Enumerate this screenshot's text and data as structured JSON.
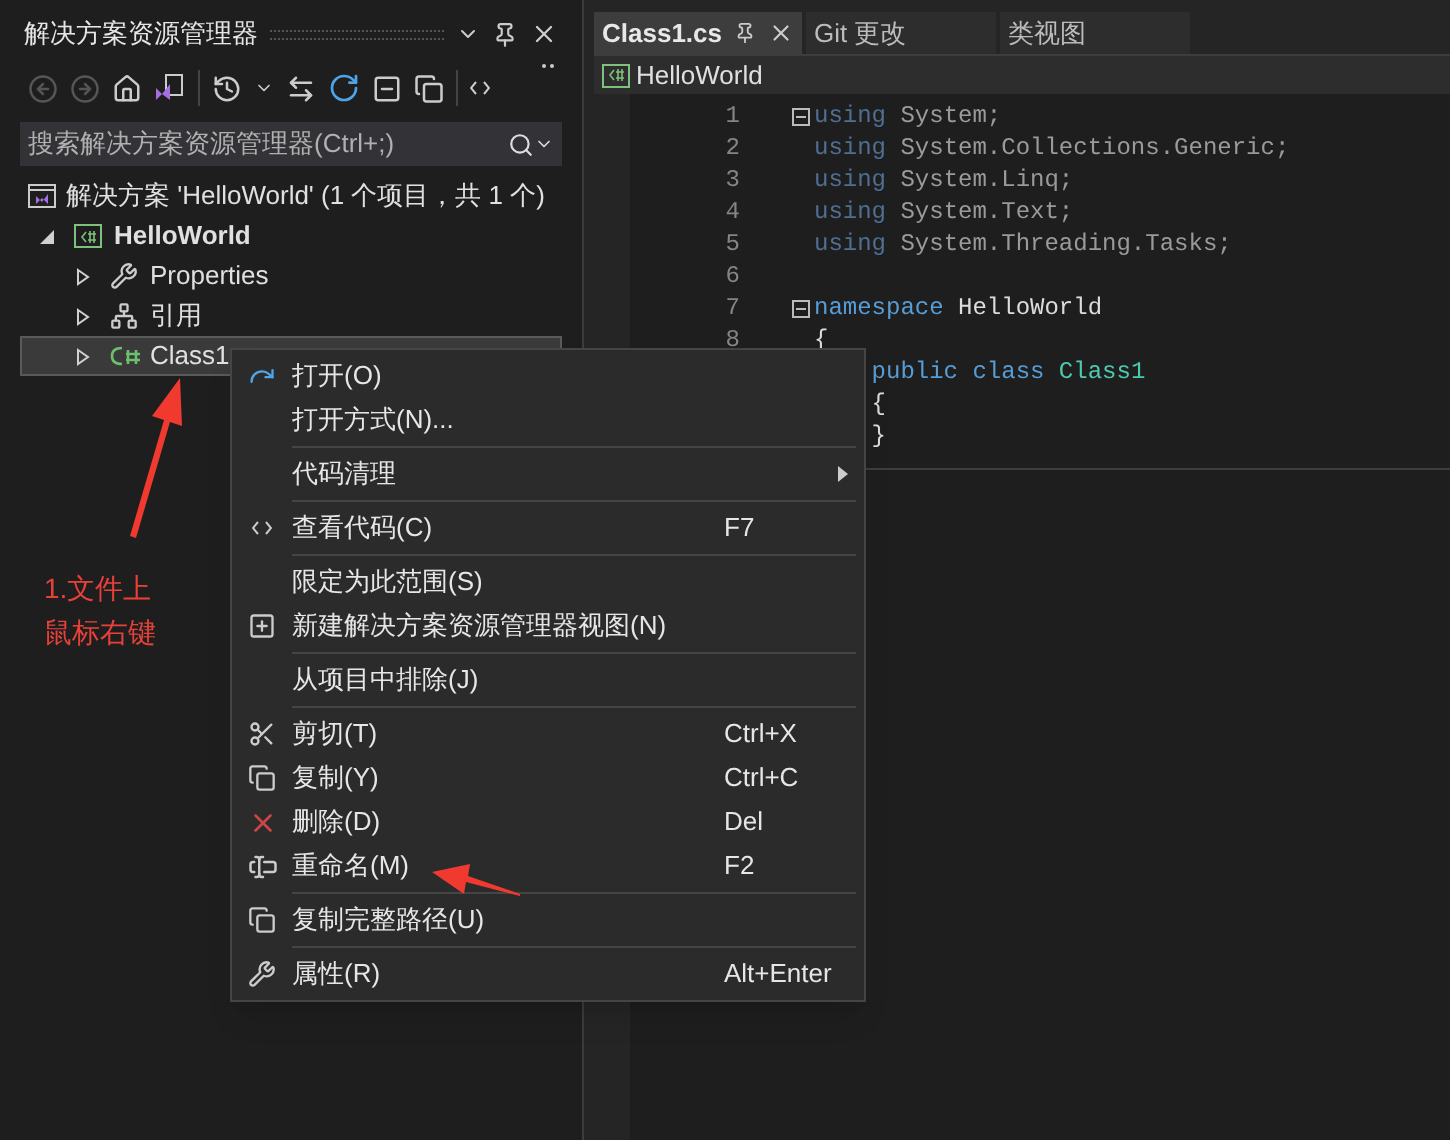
{
  "solution_explorer": {
    "title": "解决方案资源管理器",
    "search": {
      "placeholder": "搜索解决方案资源管理器(Ctrl+;)"
    },
    "tree": [
      {
        "label": "解决方案 'HelloWorld' (1 个项目，共 1 个)",
        "kind": "solution",
        "selected": false,
        "children": [
          {
            "label": "HelloWorld",
            "kind": "project",
            "selected": false,
            "expanded": true,
            "children": [
              {
                "label": "Properties",
                "kind": "properties",
                "selected": false,
                "expanded": false
              },
              {
                "label": "引用",
                "kind": "references",
                "selected": false,
                "expanded": false
              },
              {
                "label": "Class1",
                "kind": "csfile",
                "selected": true,
                "expanded": false
              }
            ]
          }
        ]
      }
    ]
  },
  "editor": {
    "tabs": [
      {
        "label": "Class1.cs",
        "selected": true
      },
      {
        "label": "Git 更改",
        "selected": false
      },
      {
        "label": "类视图",
        "selected": false
      }
    ],
    "navigation": "HelloWorld",
    "lines": [
      {
        "number": "1",
        "fold": true,
        "tokens": [
          {
            "text": "using",
            "kind": "dim"
          },
          {
            "text": " System;",
            "kind": "plain_dim"
          }
        ]
      },
      {
        "number": "2",
        "fold": false,
        "tokens": [
          {
            "text": "using",
            "kind": "dim"
          },
          {
            "text": " System.Collections.Generic;",
            "kind": "plain_dim"
          }
        ]
      },
      {
        "number": "3",
        "fold": false,
        "tokens": [
          {
            "text": "using",
            "kind": "dim"
          },
          {
            "text": " System.Linq;",
            "kind": "plain_dim"
          }
        ]
      },
      {
        "number": "4",
        "fold": false,
        "tokens": [
          {
            "text": "using",
            "kind": "dim"
          },
          {
            "text": " System.Text;",
            "kind": "plain_dim"
          }
        ]
      },
      {
        "number": "5",
        "fold": false,
        "tokens": [
          {
            "text": "using",
            "kind": "dim"
          },
          {
            "text": " System.Threading.Tasks;",
            "kind": "plain_dim"
          }
        ]
      },
      {
        "number": "6"
      },
      {
        "number": "7",
        "fold": true,
        "tokens": [
          {
            "text": "namespace",
            "kind": "keyword"
          },
          {
            "text": " HelloWorld",
            "kind": "plain"
          }
        ]
      },
      {
        "number": "8",
        "fold": false,
        "tokens": [
          {
            "text": "{",
            "kind": "plain"
          }
        ]
      },
      {
        "fold": false,
        "tokens": [
          {
            "text": "    public",
            "kind": "keyword"
          },
          {
            "text": " class",
            "kind": "keyword"
          },
          {
            "text": " Class1",
            "kind": "type"
          }
        ]
      },
      {
        "fold": false,
        "tokens": [
          {
            "text": "    {",
            "kind": "plain"
          }
        ]
      },
      {
        "fold": false,
        "tokens": [
          {
            "text": "    }",
            "kind": "plain"
          }
        ]
      }
    ]
  },
  "context_menu": [
    {
      "kind": "item",
      "label": "打开(O)"
    },
    {
      "kind": "item",
      "label": "打开方式(N)..."
    },
    {
      "kind": "separator"
    },
    {
      "kind": "submenu",
      "label": "代码清理"
    },
    {
      "kind": "separator"
    },
    {
      "kind": "item",
      "label": "查看代码(C)",
      "shortcut": "F7"
    },
    {
      "kind": "separator"
    },
    {
      "kind": "item",
      "label": "限定为此范围(S)"
    },
    {
      "kind": "item",
      "label": "新建解决方案资源管理器视图(N)"
    },
    {
      "kind": "separator"
    },
    {
      "kind": "item",
      "label": "从项目中排除(J)"
    },
    {
      "kind": "separator"
    },
    {
      "kind": "item",
      "label": "剪切(T)",
      "shortcut": "Ctrl+X"
    },
    {
      "kind": "item",
      "label": "复制(Y)",
      "shortcut": "Ctrl+C"
    },
    {
      "kind": "item",
      "label": "删除(D)",
      "shortcut": "Del"
    },
    {
      "kind": "item",
      "label": "重命名(M)",
      "shortcut": "F2"
    },
    {
      "kind": "separator"
    },
    {
      "kind": "item",
      "label": "复制完整路径(U)"
    },
    {
      "kind": "separator"
    },
    {
      "kind": "item",
      "label": "属性(R)",
      "shortcut": "Alt+Enter"
    }
  ],
  "annotation": {
    "lines": [
      "1.文件上",
      "鼠标右键"
    ]
  }
}
